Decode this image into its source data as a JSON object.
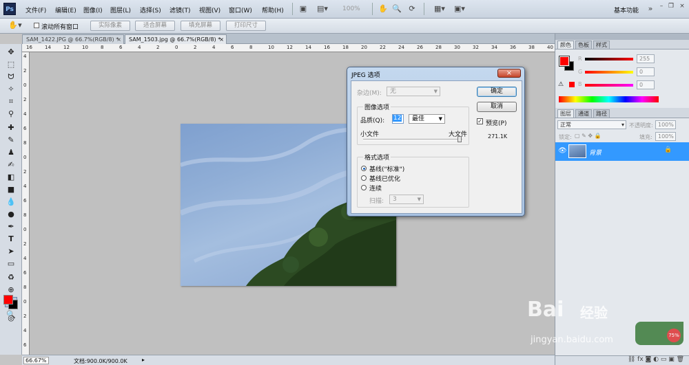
{
  "app": {
    "logo": "Ps",
    "workspace": "基本功能",
    "zoom_percent": "100%"
  },
  "menu": [
    "文件(F)",
    "编辑(E)",
    "图像(I)",
    "图层(L)",
    "选择(S)",
    "滤镜(T)",
    "视图(V)",
    "窗口(W)",
    "帮助(H)"
  ],
  "options": {
    "scroll_all": "滚动所有窗口",
    "actual_pixels": "实际像素",
    "fit_screen": "适合屏幕",
    "fill_screen": "填充屏幕",
    "print_size": "打印尺寸"
  },
  "tabs": [
    {
      "label": "SAM_1422.JPG @ 66.7%(RGB/8) *",
      "close": "×"
    },
    {
      "label": "SAM_1503.jpg @ 66.7%(RGB/8) *",
      "close": "×"
    }
  ],
  "ruler": {
    "h": [
      "16",
      "14",
      "12",
      "10",
      "8",
      "6",
      "4",
      "2",
      "0",
      "2",
      "4",
      "6",
      "8",
      "10",
      "12",
      "14",
      "16",
      "18",
      "20",
      "22",
      "24",
      "26",
      "28",
      "30",
      "32",
      "34",
      "36",
      "38",
      "40"
    ],
    "v": [
      "4",
      "2",
      "0",
      "2",
      "4",
      "6",
      "8",
      "0",
      "2",
      "4",
      "6",
      "8",
      "0",
      "2",
      "4",
      "6",
      "8",
      "0",
      "2",
      "4",
      "6"
    ]
  },
  "status": {
    "zoom": "66.67%",
    "doc": "文档:900.0K/900.0K"
  },
  "panels": {
    "color_tabs": [
      "颜色",
      "色板",
      "样式"
    ],
    "channels": [
      {
        "label": "R",
        "value": "255"
      },
      {
        "label": "G",
        "value": "0"
      },
      {
        "label": "B",
        "value": "0"
      }
    ],
    "layer_tabs": [
      "图层",
      "通道",
      "路径"
    ],
    "blend_mode": "正常",
    "opacity_label": "不透明度:",
    "opacity": "100%",
    "lock_label": "锁定:",
    "fill_label": "填充:",
    "fill": "100%",
    "layer_name": "背景"
  },
  "dialog": {
    "title": "JPEG 选项",
    "matte_label": "杂边(M):",
    "matte_value": "无",
    "image_options": "图像选项",
    "quality_label": "品质(Q):",
    "quality_value": "12",
    "quality_preset": "最佳",
    "small_file": "小文件",
    "large_file": "大文件",
    "format_options": "格式选项",
    "formats": [
      "基线(\"标准\")",
      "基线已优化",
      "连续"
    ],
    "scan_label": "扫描:",
    "scan_value": "3",
    "ok": "确定",
    "cancel": "取消",
    "preview": "预览(P)",
    "file_size": "271.1K"
  },
  "watermark": {
    "brand": "Bai",
    "brand2": "经验",
    "url": "jingyan.baidu.com",
    "badge": "75%"
  },
  "colors": {
    "foreground": "#ff0000",
    "background": "#000000",
    "accent": "#3399ff"
  }
}
